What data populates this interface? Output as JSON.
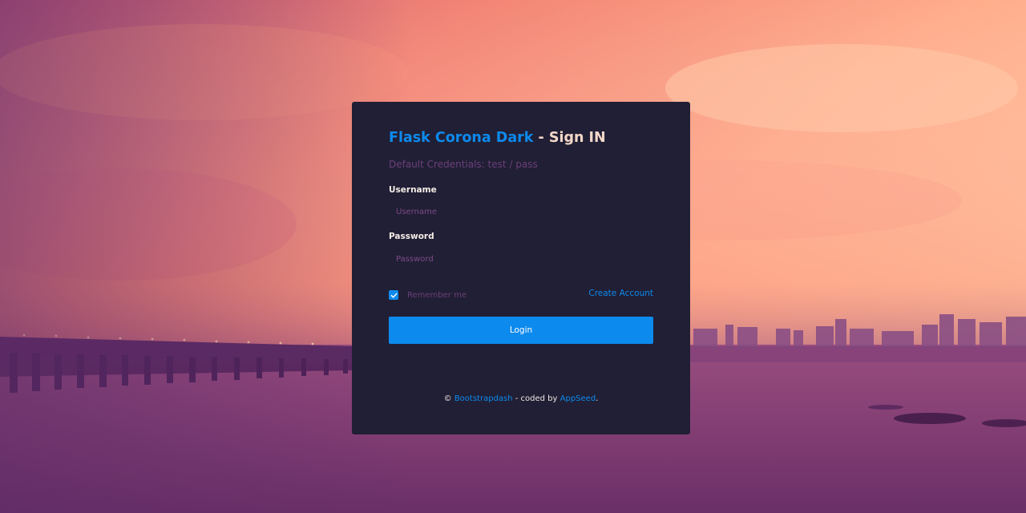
{
  "login": {
    "title_brand": "Flask Corona Dark",
    "title_rest": " - Sign IN",
    "subtitle": "Default Credentials: test / pass",
    "username": {
      "label": "Username",
      "placeholder": "Username",
      "value": ""
    },
    "password": {
      "label": "Password",
      "placeholder": "Password",
      "value": ""
    },
    "remember": {
      "label": "Remember me",
      "checked": true
    },
    "create_account": "Create Account",
    "login_button": "Login"
  },
  "footer": {
    "copyright_symbol": "©",
    "link1": "Bootstrapdash",
    "middle": " - coded by ",
    "link2": "AppSeed",
    "end": "."
  },
  "colors": {
    "card_bg": "#211f35",
    "accent": "#0d8aed",
    "muted": "#6b3f78",
    "title_rest": "#f3d8c9"
  },
  "icons": {
    "checkbox": "checkmark-icon"
  }
}
